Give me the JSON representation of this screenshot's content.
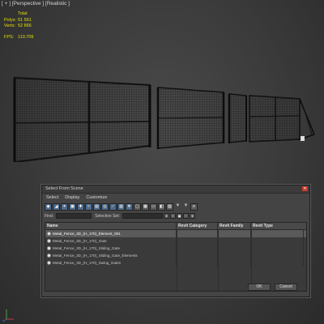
{
  "viewport": {
    "label": "[ + ] [Perspective ] [Realistic ]",
    "stats": {
      "total_label": "Total",
      "polys_label": "Polys:",
      "polys_value": "51 561",
      "verts_label": "Verts:",
      "verts_value": "52 866",
      "fps_label": "FPS:",
      "fps_value": "110.709"
    }
  },
  "dialog": {
    "title": "Select From Scene",
    "menu": [
      "Select",
      "Display",
      "Customize"
    ],
    "find_label": "Find:",
    "find_value": "",
    "selection_set_label": "Selection Set:",
    "selection_set_value": "",
    "columns": [
      "Name",
      "Revit Category",
      "Revit Family",
      "Revit Type"
    ],
    "rows": [
      {
        "name": "Metal_Fence_3D_(H_170)_Element_001",
        "selected": true
      },
      {
        "name": "Metal_Fence_3D_(H_170)_Gate",
        "selected": false
      },
      {
        "name": "Metal_Fence_3D_(H_170)_Sliding_Gate",
        "selected": false
      },
      {
        "name": "Metal_Fence_3D_(H_170)_Sliding_Gate_Elements",
        "selected": false
      },
      {
        "name": "Metal_Fence_3D_(H_170)_Swing_Gates",
        "selected": false
      }
    ],
    "ok_label": "OK",
    "cancel_label": "Cancel",
    "close_glyph": "✕"
  },
  "colors": {
    "accent": "#4d6b8f",
    "close": "#c43a2e",
    "stats_text": "#e0e000"
  }
}
